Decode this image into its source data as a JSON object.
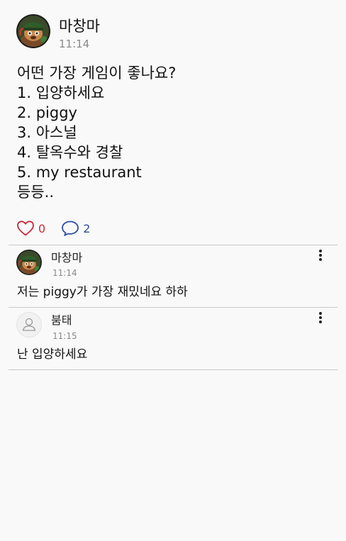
{
  "post": {
    "author": "마창마",
    "time": "11:14",
    "avatar_icon": "game-character-avatar-icon",
    "body_lines": [
      "어떤 가장 게임이 좋나요?",
      "1. 입양하세요",
      "2. piggy",
      "3. 아스널",
      "4. 탈옥수와 경찰",
      "5. my restaurant",
      "등등.."
    ],
    "likes": "0",
    "comments": "2",
    "like_icon": "heart-outline-icon",
    "comment_icon": "speech-bubble-icon",
    "like_color": "#c62b3a",
    "comment_color": "#2d4fa0"
  },
  "comments": [
    {
      "author": "마창마",
      "time": "11:14",
      "text": "저는 piggy가 가장 재밌네요 하하",
      "avatar_icon": "game-character-avatar-icon",
      "more_icon": "more-vertical-icon"
    },
    {
      "author": "붐태",
      "time": "11:15",
      "text": "난 입양하세요",
      "avatar_icon": "default-user-avatar-icon",
      "more_icon": "more-vertical-icon"
    }
  ]
}
